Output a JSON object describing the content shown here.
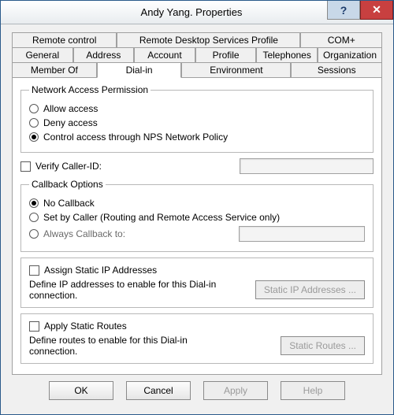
{
  "window": {
    "title": "Andy Yang. Properties",
    "help_glyph": "?",
    "close_glyph": "✕"
  },
  "tabs": {
    "row1": [
      "Remote control",
      "Remote Desktop Services Profile",
      "COM+"
    ],
    "row2": [
      "General",
      "Address",
      "Account",
      "Profile",
      "Telephones",
      "Organization"
    ],
    "row3": [
      "Member Of",
      "Dial-in",
      "Environment",
      "Sessions"
    ],
    "active": "Dial-in"
  },
  "networkAccess": {
    "legend": "Network Access Permission",
    "allow": "Allow access",
    "deny": "Deny access",
    "control": "Control access through NPS Network Policy",
    "selected": "control"
  },
  "verifyCaller": {
    "label": "Verify Caller-ID:",
    "checked": false,
    "value": ""
  },
  "callback": {
    "legend": "Callback Options",
    "none": "No Callback",
    "setByCaller": "Set by Caller (Routing and Remote Access Service only)",
    "always": "Always Callback to:",
    "selected": "none",
    "alwaysValue": ""
  },
  "staticIp": {
    "label": "Assign Static IP Addresses",
    "checked": false,
    "desc": "Define IP addresses to enable for this Dial-in connection.",
    "button": "Static IP Addresses ..."
  },
  "staticRoutes": {
    "label": "Apply Static Routes",
    "checked": false,
    "desc": "Define routes to enable for this Dial-in connection.",
    "button": "Static Routes ..."
  },
  "footer": {
    "ok": "OK",
    "cancel": "Cancel",
    "apply": "Apply",
    "help": "Help"
  }
}
